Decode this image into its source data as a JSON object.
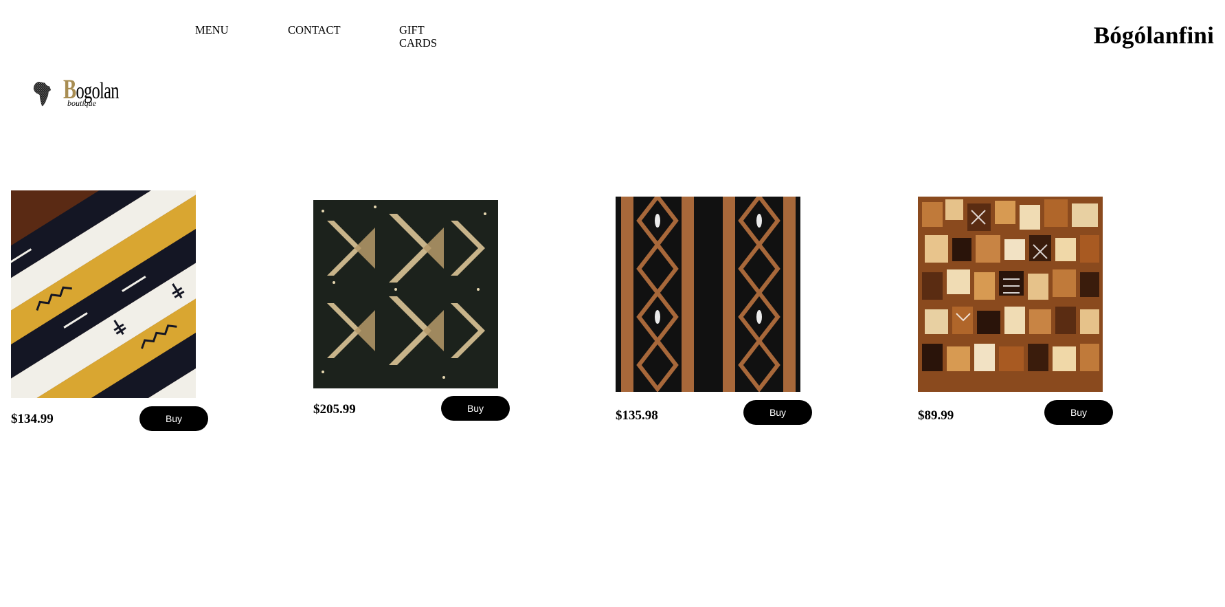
{
  "nav": {
    "menu": "MENU",
    "contact": "CONTACT",
    "gift_cards": "GIFT CARDS"
  },
  "brand": {
    "name": "Bógólanfini",
    "logo_text": "Bogolan",
    "logo_subtext": "boutique",
    "logo_icon": "africa-map-icon",
    "accent_color": "#a88d52"
  },
  "products": [
    {
      "price": "$134.99",
      "buy_label": "Buy",
      "swatch": "mudcloth-diagonal-stripes"
    },
    {
      "price": "$205.99",
      "buy_label": "Buy",
      "swatch": "mudcloth-dark-zigzag"
    },
    {
      "price": "$135.98",
      "buy_label": "Buy",
      "swatch": "mudcloth-brown-diamonds"
    },
    {
      "price": "$89.99",
      "buy_label": "Buy",
      "swatch": "mudcloth-patchwork"
    }
  ]
}
